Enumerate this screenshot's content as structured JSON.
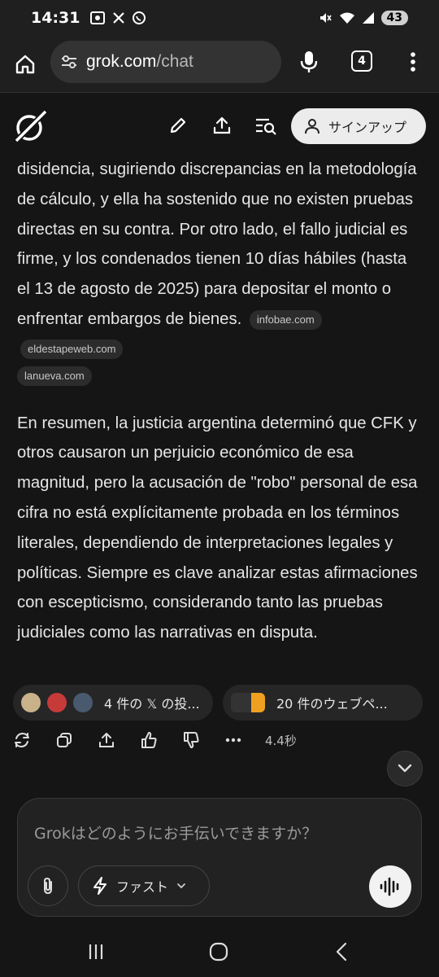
{
  "status_bar": {
    "time": "14:31",
    "battery": "43",
    "left_icons": [
      "screenshot-icon",
      "x-icon",
      "whatsapp-icon"
    ],
    "right_icons": [
      "mute-icon",
      "wifi-icon",
      "signal-icon",
      "battery-icon"
    ]
  },
  "browser": {
    "url_domain": "grok.com",
    "url_path": "/chat",
    "tab_count": "4"
  },
  "header": {
    "signup_label": "サインアップ"
  },
  "message": {
    "para1": "disidencia, sugiriendo discrepancias en la metodología de cálculo, y ella ha sostenido que no existen pruebas directas en su contra. Por otro lado, el fallo judicial es firme, y los condenados tienen 10 días hábiles (hasta el 13 de agosto de 2025) para depositar el monto o enfrentar embargos de bienes.",
    "para1_sources": [
      "infobae.com",
      "eldestapeweb.com",
      "lanueva.com"
    ],
    "para2": "En resumen, la justicia argentina determinó que CFK y otros causaron un perjuicio económico de esa magnitud, pero la acusación de \"robo\" personal de esa cifra no está explícitamente probada en los términos literales, dependiendo de interpretaciones legales y políticas. Siempre es clave analizar estas afirmaciones con escepticismo, considerando tanto las pruebas judiciales como las narrativas en disputa."
  },
  "sources": {
    "x_posts_label": "4 件の 𝕏 の投...",
    "web_pages_label": "20 件のウェブペ..."
  },
  "actions": {
    "response_time": "4.4秒"
  },
  "composer": {
    "placeholder": "Grokはどのようにお手伝いできますか？",
    "mode_label": "ファスト"
  },
  "colors": {
    "background": "#151515",
    "text": "#e6e6e6",
    "chip_bg": "#2c2c2c",
    "signup_bg": "#ececec"
  }
}
